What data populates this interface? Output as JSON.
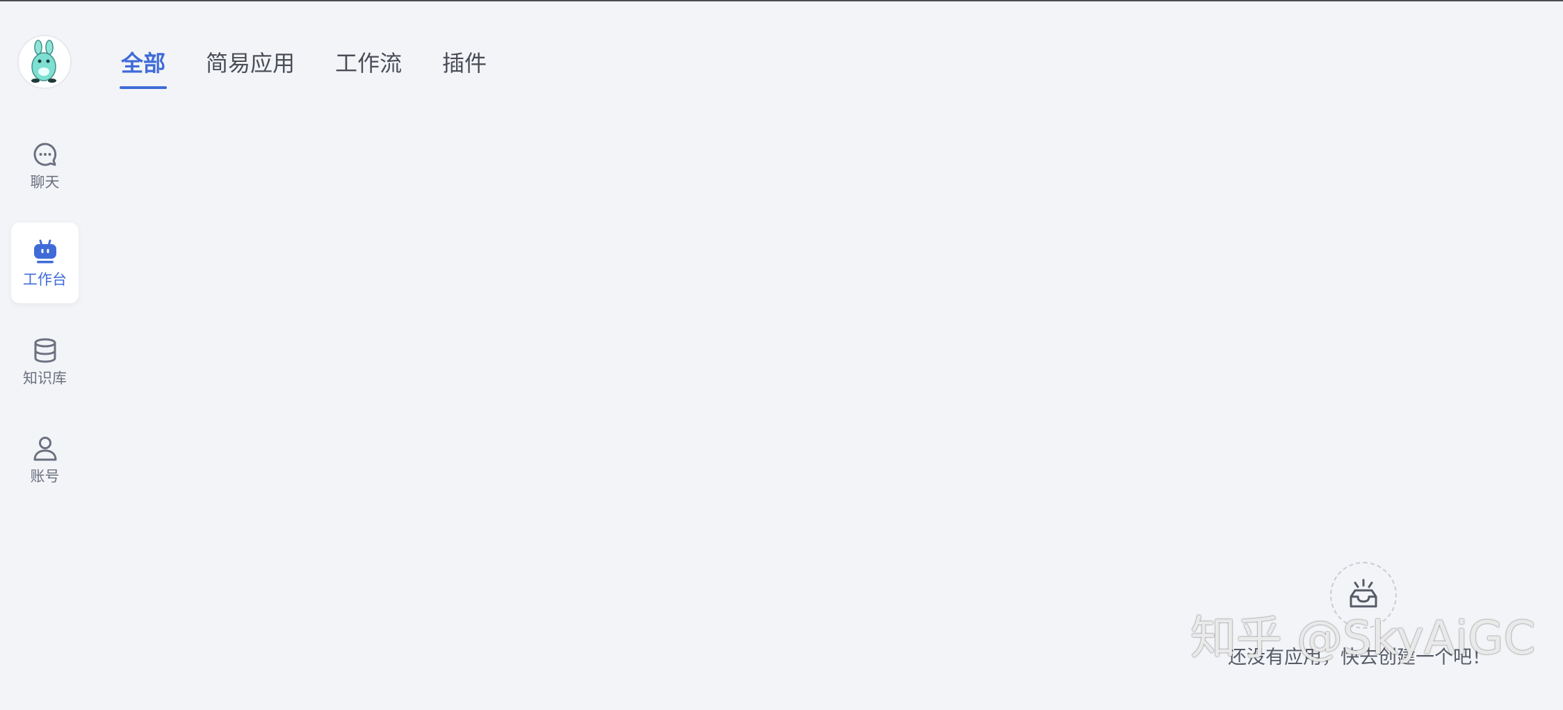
{
  "sidebar": {
    "items": [
      {
        "label": "聊天",
        "icon": "chat-bubble-icon"
      },
      {
        "label": "工作台",
        "icon": "robot-icon",
        "active": true
      },
      {
        "label": "知识库",
        "icon": "database-icon"
      },
      {
        "label": "账号",
        "icon": "user-icon"
      }
    ]
  },
  "tabs": [
    {
      "label": "全部",
      "active": true
    },
    {
      "label": "简易应用"
    },
    {
      "label": "工作流"
    },
    {
      "label": "插件"
    }
  ],
  "empty_state": {
    "message": "还没有应用，快去创建一个吧！",
    "icon": "inbox-icon"
  },
  "watermark": {
    "text": "知乎 @SkyAiGC"
  },
  "colors": {
    "background": "#f3f4f7",
    "accent": "#3f6bd8",
    "inactive_icon": "#6b7080",
    "tab_text": "#4a4d57",
    "avatar_mascot": "#7ee0d2"
  }
}
